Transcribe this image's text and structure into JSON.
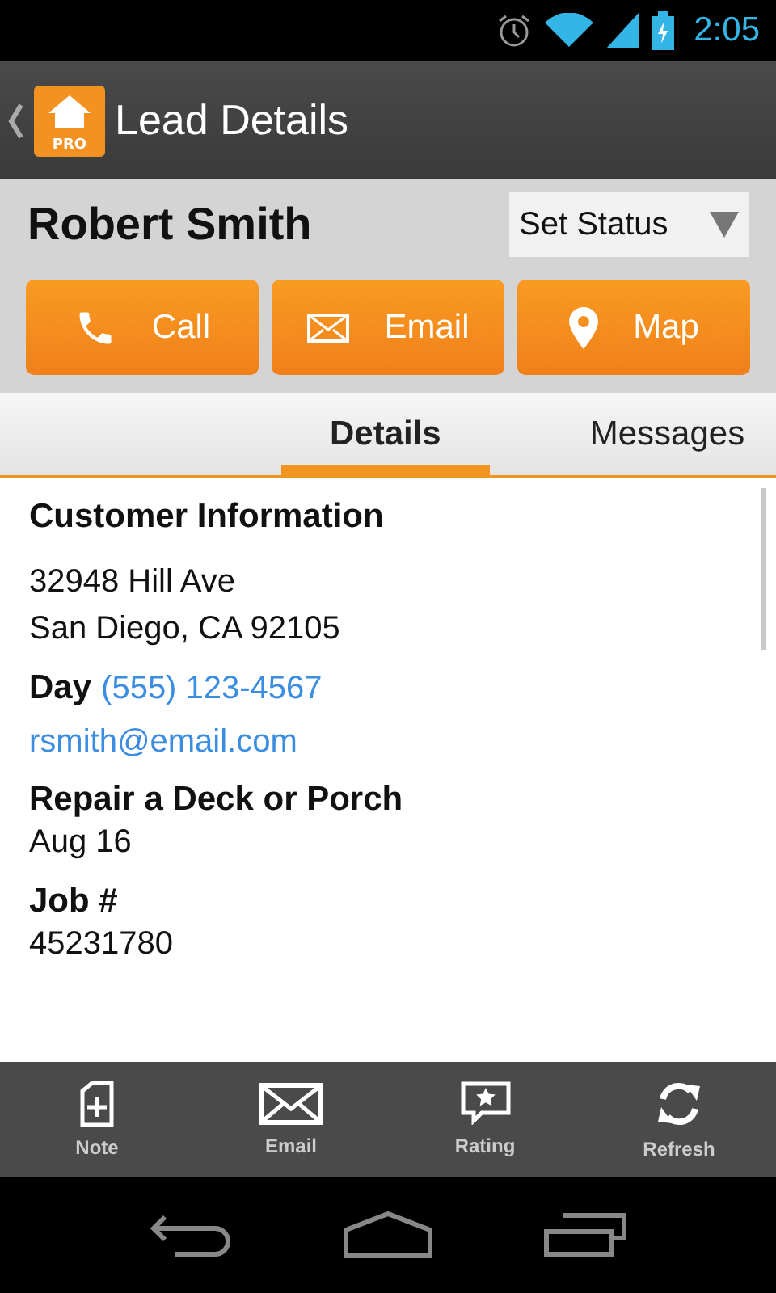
{
  "status_bar": {
    "time": "2:05"
  },
  "action_bar": {
    "title": "Lead Details",
    "logo_badge": "PRO"
  },
  "lead": {
    "name": "Robert Smith",
    "status_select": {
      "placeholder": "Set Status"
    }
  },
  "actions": [
    {
      "kind": "call",
      "label": "Call"
    },
    {
      "kind": "email",
      "label": "Email"
    },
    {
      "kind": "map",
      "label": "Map"
    }
  ],
  "tabs": [
    {
      "label": "Details",
      "selected": true
    },
    {
      "label": "Messages",
      "selected": false
    }
  ],
  "details": {
    "heading": "Customer Information",
    "address": [
      "32948 Hill Ave",
      "San Diego, CA 92105"
    ],
    "phone_label": "Day",
    "phone": "(555) 123-4567",
    "email": "rsmith@email.com",
    "sections": [
      {
        "title": "Repair a Deck or Porch",
        "value": "Aug 16"
      },
      {
        "title": "Job #",
        "value": "45231780"
      }
    ]
  },
  "toolbar": [
    {
      "kind": "note",
      "label": "Note"
    },
    {
      "kind": "email",
      "label": "Email"
    },
    {
      "kind": "rating",
      "label": "Rating"
    },
    {
      "kind": "refresh",
      "label": "Refresh"
    }
  ]
}
